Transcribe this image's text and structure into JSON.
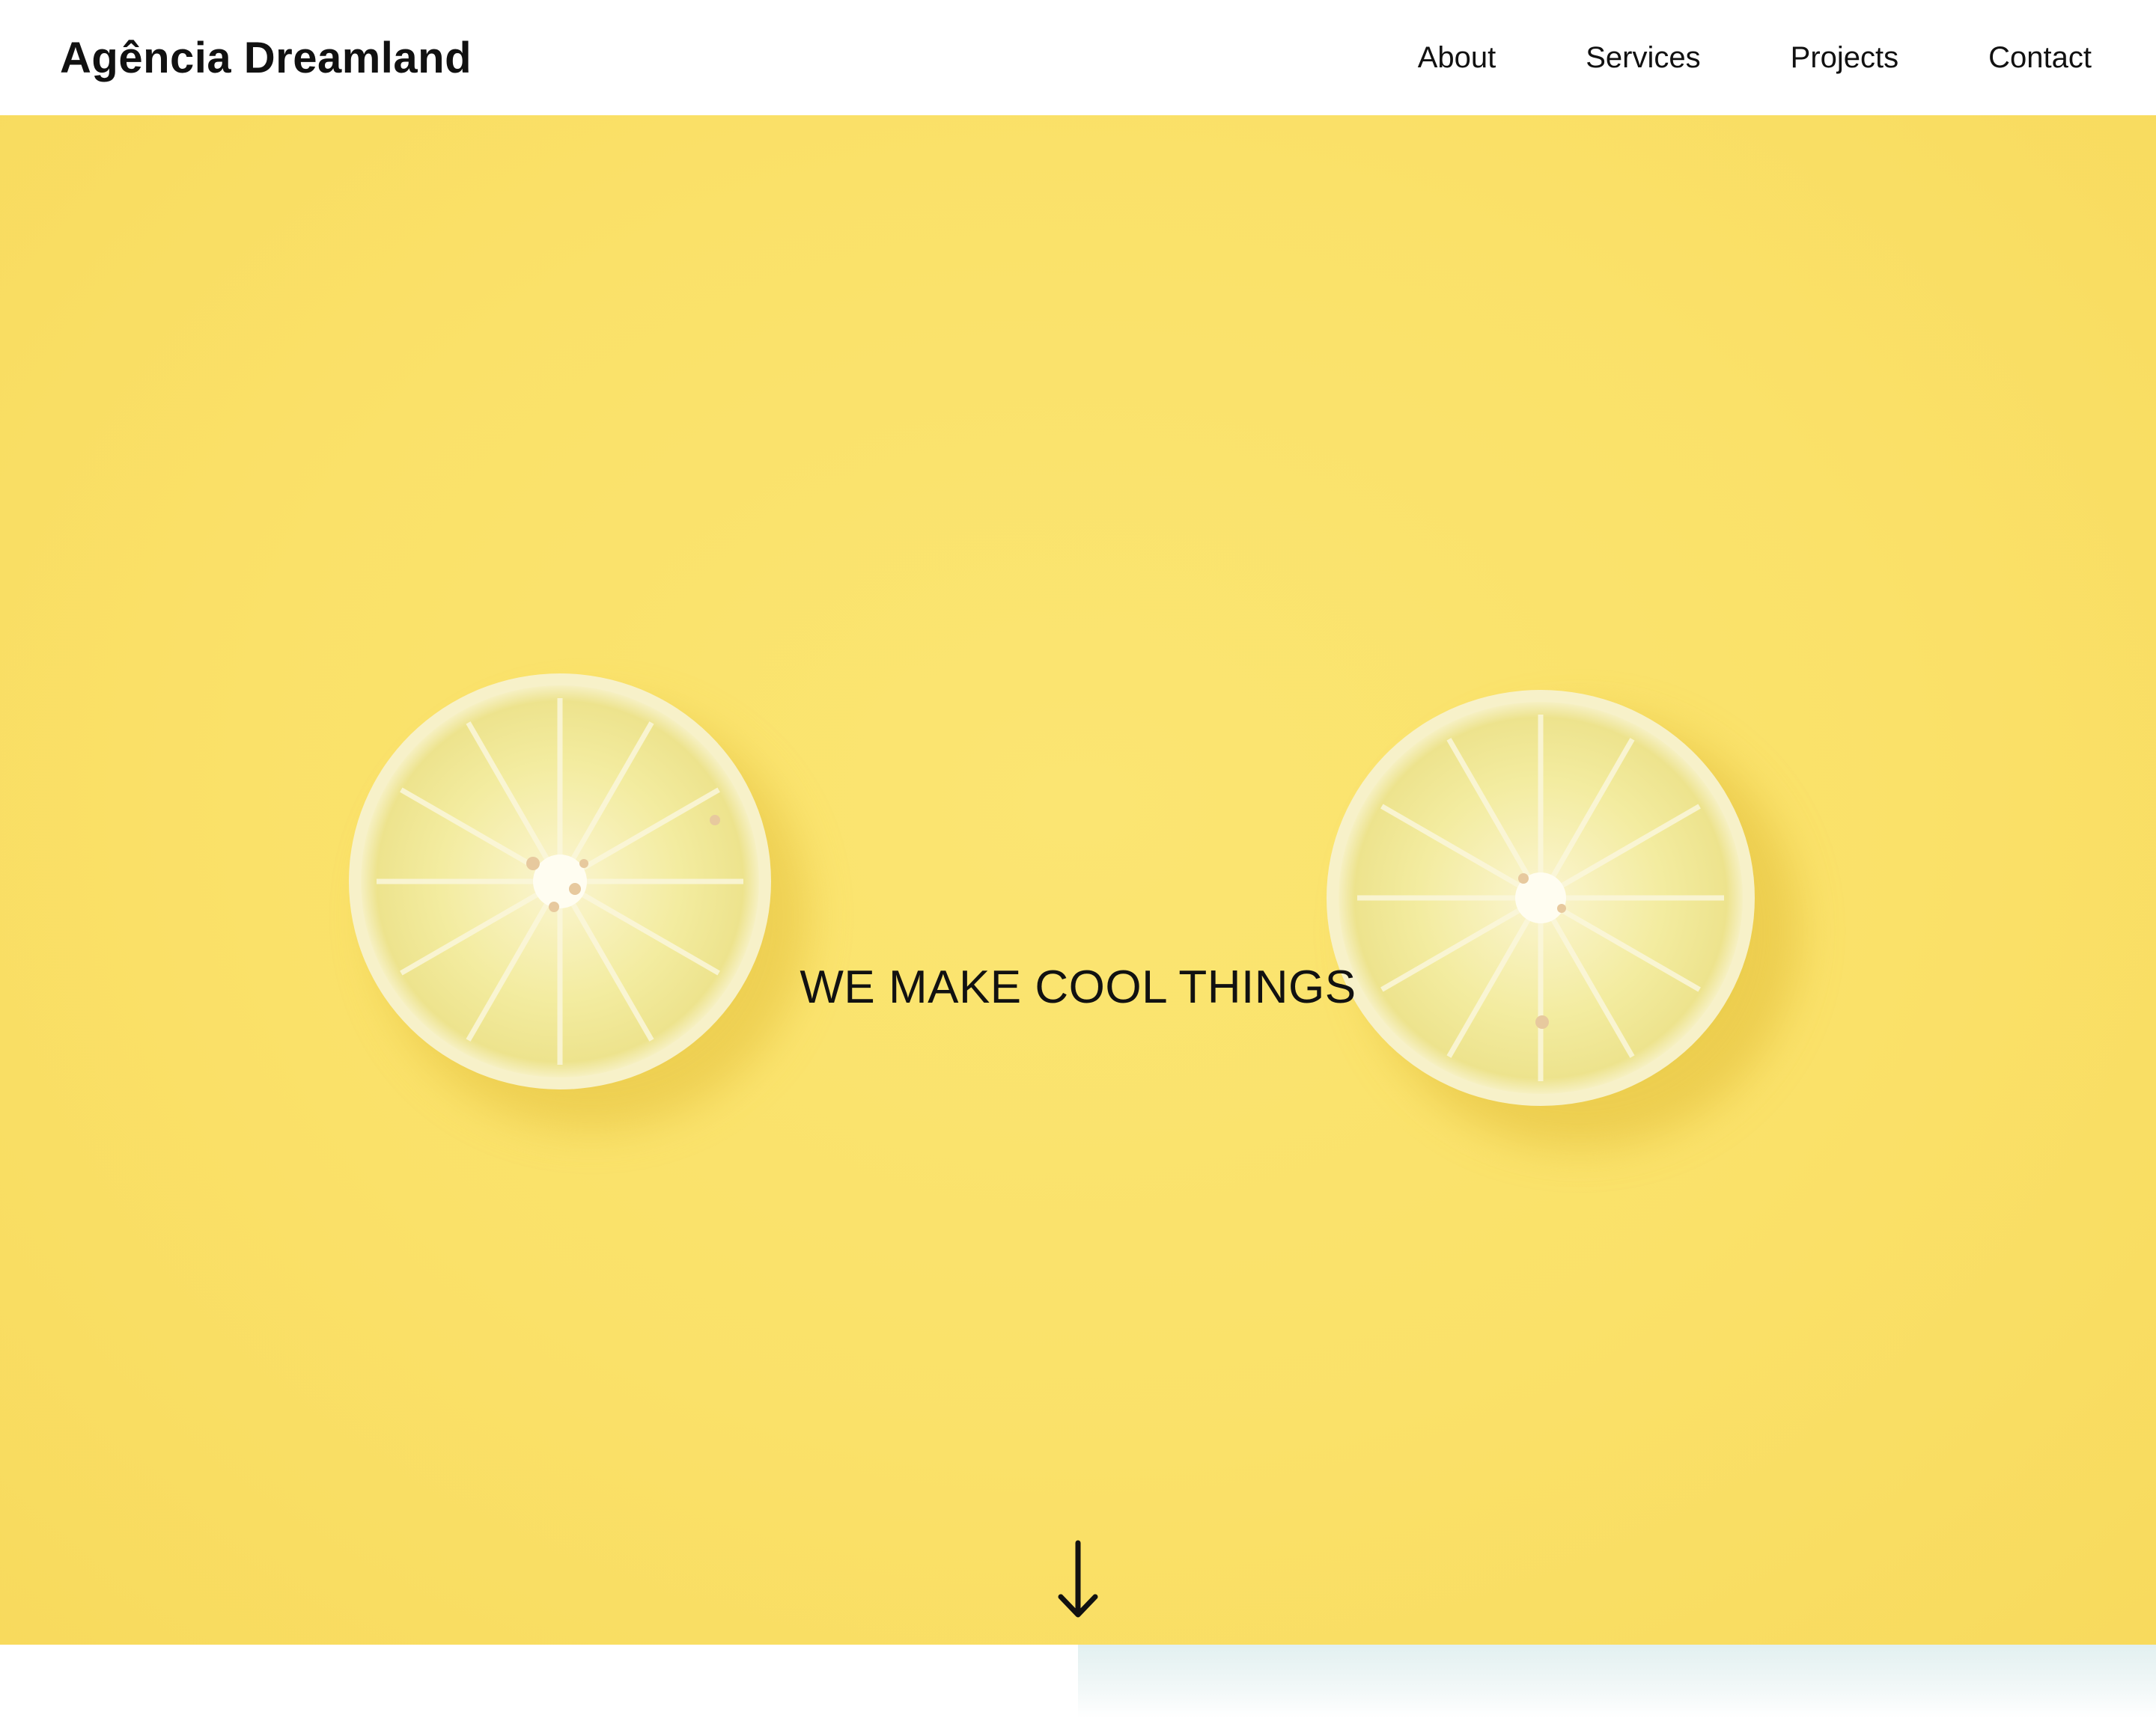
{
  "header": {
    "brand": "Agência Dreamland",
    "nav": {
      "about": "About",
      "services": "Services",
      "projects": "Projects",
      "contact": "Contact"
    }
  },
  "hero": {
    "headline": "WE MAKE COOL THINGS",
    "background_color": "#fae169",
    "image": "two lemon slices on yellow background",
    "scroll_icon": "arrow-down-icon"
  },
  "next_section": {
    "image": "pale teal photo (partially visible)"
  }
}
